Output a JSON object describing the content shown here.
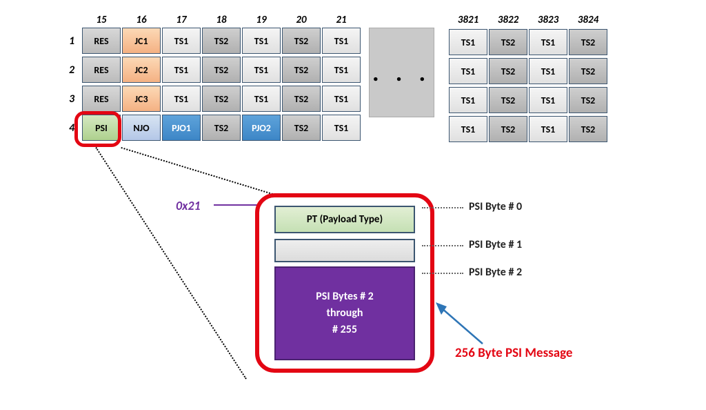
{
  "columns_left": [
    "15",
    "16",
    "17",
    "18",
    "19",
    "20",
    "21"
  ],
  "columns_right": [
    "3821",
    "3822",
    "3823",
    "3824"
  ],
  "rows": [
    "1",
    "2",
    "3",
    "4"
  ],
  "grid_left": [
    [
      {
        "t": "RES",
        "c": "res"
      },
      {
        "t": "JC1",
        "c": "jc"
      },
      {
        "t": "TS1",
        "c": ""
      },
      {
        "t": "TS2",
        "c": "ts2"
      },
      {
        "t": "TS1",
        "c": ""
      },
      {
        "t": "TS2",
        "c": "ts2"
      },
      {
        "t": "TS1",
        "c": ""
      }
    ],
    [
      {
        "t": "RES",
        "c": "res"
      },
      {
        "t": "JC2",
        "c": "jc"
      },
      {
        "t": "TS1",
        "c": ""
      },
      {
        "t": "TS2",
        "c": "ts2"
      },
      {
        "t": "TS1",
        "c": ""
      },
      {
        "t": "TS2",
        "c": "ts2"
      },
      {
        "t": "TS1",
        "c": ""
      }
    ],
    [
      {
        "t": "RES",
        "c": "res"
      },
      {
        "t": "JC3",
        "c": "jc"
      },
      {
        "t": "TS1",
        "c": ""
      },
      {
        "t": "TS2",
        "c": "ts2"
      },
      {
        "t": "TS1",
        "c": ""
      },
      {
        "t": "TS2",
        "c": "ts2"
      },
      {
        "t": "TS1",
        "c": ""
      }
    ],
    [
      {
        "t": "PSI",
        "c": "psi"
      },
      {
        "t": "NJO",
        "c": "njo"
      },
      {
        "t": "PJO1",
        "c": "pjo"
      },
      {
        "t": "TS2",
        "c": "ts2"
      },
      {
        "t": "PJO2",
        "c": "pjo"
      },
      {
        "t": "TS2",
        "c": "ts2"
      },
      {
        "t": "TS1",
        "c": ""
      }
    ]
  ],
  "grid_right": [
    [
      {
        "t": "TS1",
        "c": ""
      },
      {
        "t": "TS2",
        "c": "ts2"
      },
      {
        "t": "TS1",
        "c": ""
      },
      {
        "t": "TS2",
        "c": "ts2"
      }
    ],
    [
      {
        "t": "TS1",
        "c": ""
      },
      {
        "t": "TS2",
        "c": "ts2"
      },
      {
        "t": "TS1",
        "c": ""
      },
      {
        "t": "TS2",
        "c": "ts2"
      }
    ],
    [
      {
        "t": "TS1",
        "c": ""
      },
      {
        "t": "TS2",
        "c": "ts2"
      },
      {
        "t": "TS1",
        "c": ""
      },
      {
        "t": "TS2",
        "c": "ts2"
      }
    ],
    [
      {
        "t": "TS1",
        "c": ""
      },
      {
        "t": "TS2",
        "c": "ts2"
      },
      {
        "t": "TS1",
        "c": ""
      },
      {
        "t": "TS2",
        "c": "ts2"
      }
    ]
  ],
  "ellipsis": ". . .",
  "payload": {
    "hex": "0x21",
    "pt_label": "PT (Payload Type)",
    "rest_l1": "PSI Bytes # 2",
    "rest_l2": "through",
    "rest_l3": "# 255",
    "byte0": "PSI Byte # 0",
    "byte1": "PSI Byte # 1",
    "byte2": "PSI Byte # 2",
    "message": "256 Byte PSI Message"
  }
}
